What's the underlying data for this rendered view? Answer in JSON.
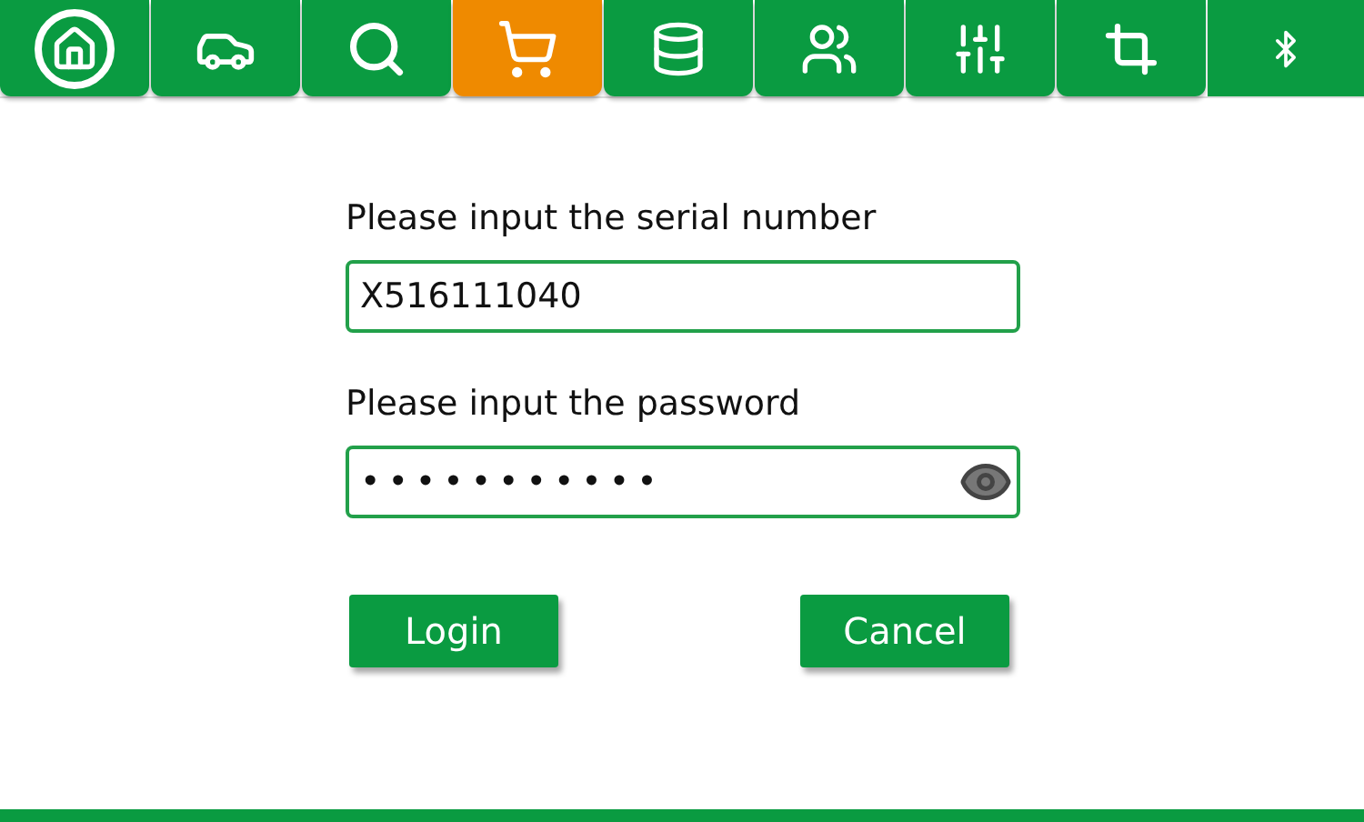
{
  "toolbar": {
    "tabs": [
      {
        "selected": false
      },
      {
        "selected": false
      },
      {
        "selected": false
      },
      {
        "selected": true
      },
      {
        "selected": false
      },
      {
        "selected": false
      },
      {
        "selected": false
      },
      {
        "selected": false
      }
    ]
  },
  "form": {
    "serial_label": "Please input the serial number",
    "serial_value": "X516111040",
    "password_label": "Please input the password",
    "password_value": "•••••••••••"
  },
  "buttons": [
    "Login",
    "Cancel"
  ]
}
